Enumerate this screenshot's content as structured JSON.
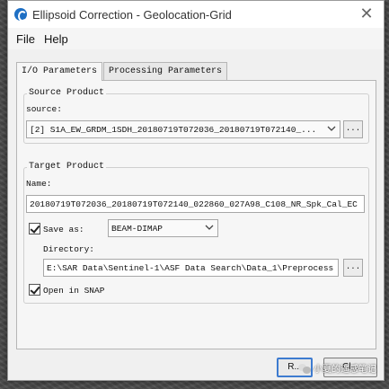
{
  "window": {
    "title": "Ellipsoid Correction - Geolocation-Grid",
    "close_glyph": "✕"
  },
  "menu": {
    "items": [
      "File",
      "Help"
    ]
  },
  "tabs": [
    {
      "label": "I/O Parameters",
      "active": true
    },
    {
      "label": "Processing Parameters",
      "active": false
    }
  ],
  "source_product": {
    "group_title": "Source Product",
    "source_label": "source:",
    "source_value": "[2] S1A_EW_GRDM_1SDH_20180719T072036_20180719T072140_...",
    "browse_label": "..."
  },
  "target_product": {
    "group_title": "Target Product",
    "name_label": "Name:",
    "name_value": "20180719T072036_20180719T072140_022860_027A98_C108_NR_Spk_Cal_EC",
    "save_as_label": "Save as:",
    "save_as_checked": true,
    "format_value": "BEAM-DIMAP",
    "directory_label": "Directory:",
    "directory_value": "E:\\SAR Data\\Sentinel-1\\ASF Data Search\\Data_1\\Preprocess",
    "browse_label": "...",
    "open_in_snap_label": "Open in SNAP",
    "open_in_snap_checked": true
  },
  "buttons": {
    "run_label": "R...",
    "close_label": "Cl..."
  },
  "watermark": {
    "text": "小夏的遥感笔记"
  }
}
